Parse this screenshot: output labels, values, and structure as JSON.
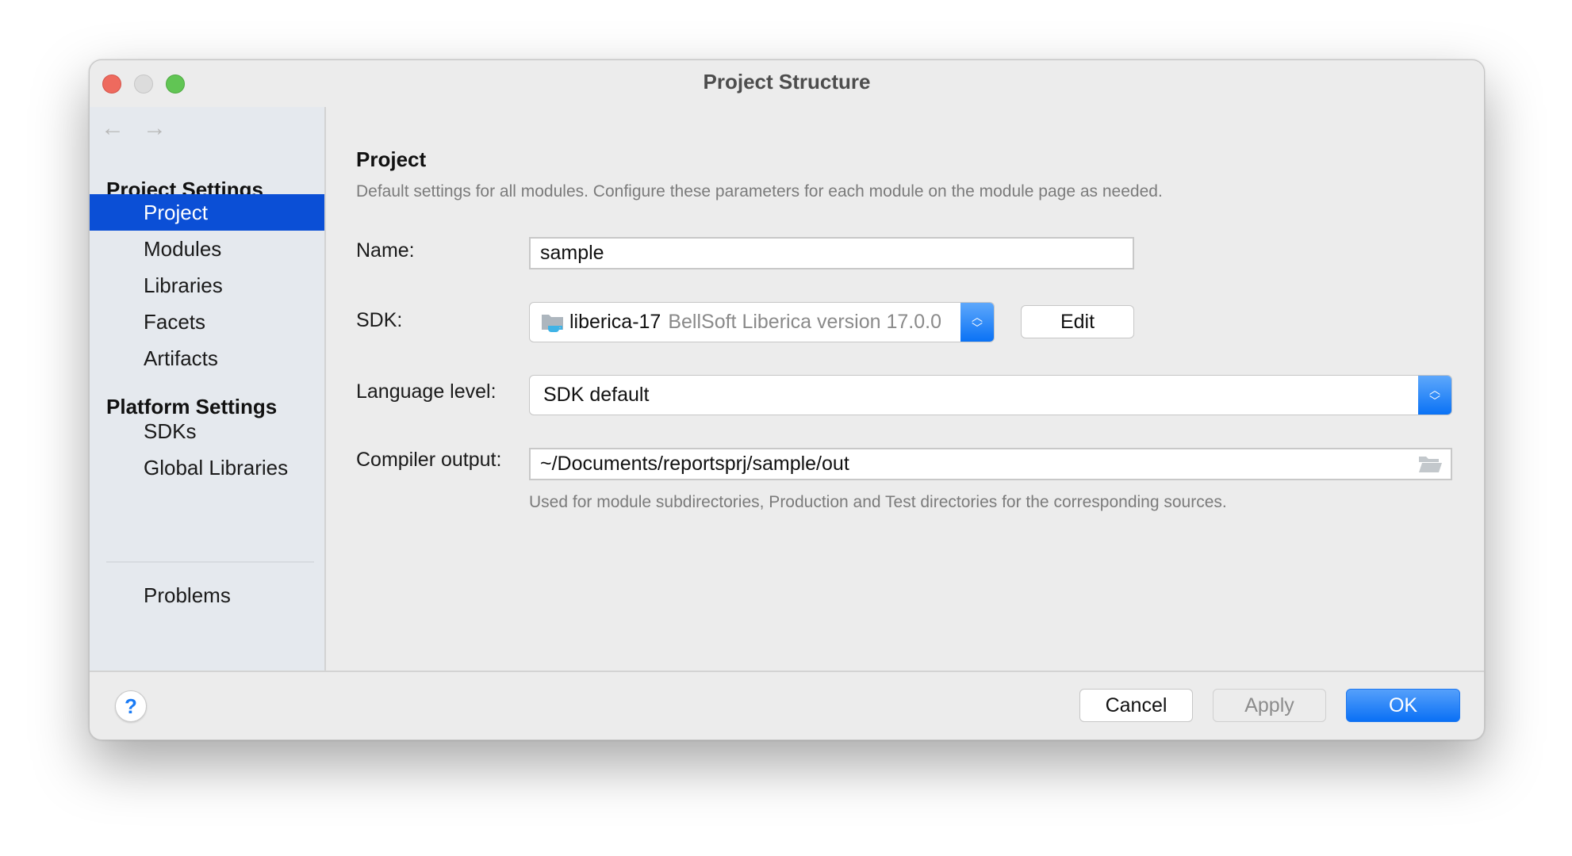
{
  "window": {
    "title": "Project Structure"
  },
  "sidebar": {
    "back_icon": "←",
    "forward_icon": "→",
    "sections": [
      {
        "heading": "Project Settings",
        "items": [
          {
            "label": "Project",
            "selected": true
          },
          {
            "label": "Modules"
          },
          {
            "label": "Libraries"
          },
          {
            "label": "Facets"
          },
          {
            "label": "Artifacts"
          }
        ]
      },
      {
        "heading": "Platform Settings",
        "items": [
          {
            "label": "SDKs"
          },
          {
            "label": "Global Libraries"
          }
        ]
      }
    ],
    "problems_label": "Problems"
  },
  "main": {
    "title": "Project",
    "description": "Default settings for all modules. Configure these parameters for each module on the module page as needed.",
    "name": {
      "label": "Name:",
      "value": "sample"
    },
    "sdk": {
      "label": "SDK:",
      "value_name": "liberica-17",
      "value_detail": "BellSoft Liberica version 17.0.0",
      "edit_label": "Edit"
    },
    "language_level": {
      "label": "Language level:",
      "value": "SDK default"
    },
    "compiler_output": {
      "label": "Compiler output:",
      "value": "~/Documents/reportsprj/sample/out",
      "hint": "Used for module subdirectories, Production and Test directories for the corresponding sources."
    }
  },
  "footer": {
    "help_label": "?",
    "cancel_label": "Cancel",
    "apply_label": "Apply",
    "ok_label": "OK"
  },
  "colors": {
    "selection": "#0b4fd6",
    "accent": "#0a72f5"
  }
}
